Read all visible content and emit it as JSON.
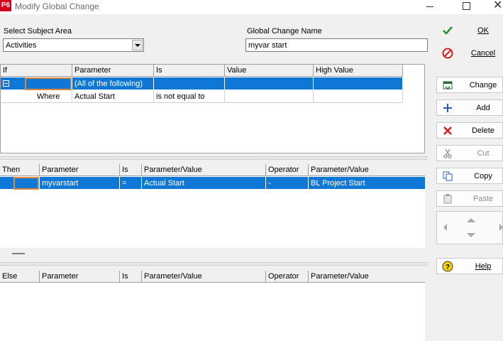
{
  "window": {
    "app_icon_text": "P6",
    "title": "Modify Global Change",
    "minimize_glyph": "—",
    "maximize_glyph": "☐",
    "close_glyph": "✕"
  },
  "form": {
    "subject_area_label": "Select Subject Area",
    "subject_area_value": "Activities",
    "global_change_name_label": "Global Change Name",
    "global_change_name_value": "myvar start"
  },
  "if_grid": {
    "headers": [
      "If",
      "Parameter",
      "Is",
      "Value",
      "High Value"
    ],
    "rows": [
      {
        "if": "",
        "parameter": "(All of the following)",
        "is": "",
        "value": "",
        "high_value": "",
        "selected": true
      },
      {
        "if": "Where",
        "parameter": "Actual Start",
        "is": "is not equal to",
        "value": "",
        "high_value": "",
        "selected": false
      }
    ]
  },
  "then_grid": {
    "headers": [
      "Then",
      "Parameter",
      "Is",
      "Parameter/Value",
      "Operator",
      "Parameter/Value"
    ],
    "rows": [
      {
        "then": "",
        "parameter": "myvarstart",
        "is": "=",
        "parameter_value": "Actual Start",
        "operator": "-",
        "parameter_value2": "BL Project Start",
        "selected": true
      }
    ]
  },
  "else_grid": {
    "headers": [
      "Else",
      "Parameter",
      "Is",
      "Parameter/Value",
      "Operator",
      "Parameter/Value"
    ],
    "rows": []
  },
  "buttons": {
    "ok": "OK",
    "cancel": "Cancel",
    "change": "Change",
    "add": "Add",
    "delete": "Delete",
    "cut": "Cut",
    "copy": "Copy",
    "paste": "Paste",
    "help": "Help"
  },
  "colors": {
    "selection": "#0f78d6",
    "focus": "#e0893a",
    "ok_check": "#2e8b2e",
    "cancel_red": "#d21f1f",
    "help_yellow": "#f2d400"
  }
}
